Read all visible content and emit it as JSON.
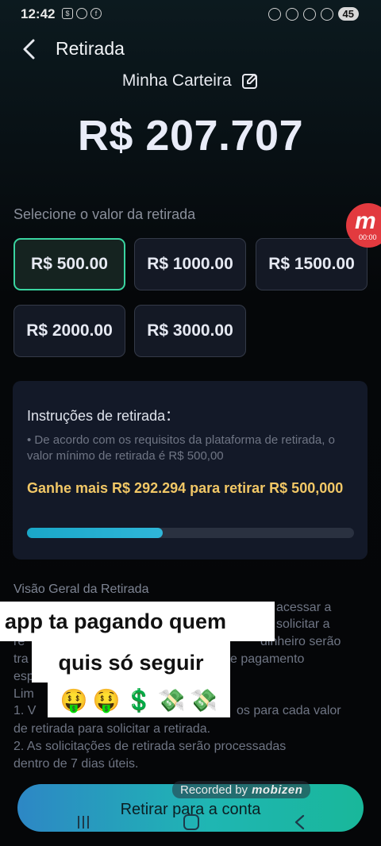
{
  "status_bar": {
    "time": "12:42",
    "left_icons": [
      "shopping-bag-icon",
      "whatsapp-icon",
      "facebook-icon"
    ],
    "right_icons": [
      "mute-icon",
      "wifi-icon",
      "do-not-disturb-icon",
      "block-icon"
    ],
    "battery": "45"
  },
  "header": {
    "title": "Retirada"
  },
  "wallet": {
    "label": "Minha Carteira",
    "balance": "R$ 207.707"
  },
  "amounts": {
    "label": "Selecione o valor da retirada",
    "options": [
      "R$ 500.00",
      "R$ 1000.00",
      "R$ 1500.00",
      "R$ 2000.00",
      "R$ 3000.00"
    ],
    "selected_index": 0
  },
  "recorder_badge": {
    "letter": "m",
    "timer": "00:00"
  },
  "instructions": {
    "title": "Instruções de retirada：",
    "text": "• De acordo com os requisitos da plataforma de retirada, o valor mínimo de retirada é R$ 500,00",
    "earn_more": "Ganhe mais R$ 292.294 para retirar R$ 500,000",
    "progress_fraction": 0.415
  },
  "overview": {
    "title": "Visão Geral da Retirada",
    "fragments": [
      "acessar a",
      "solicitar a",
      "re",
      "dinheiro serão",
      "tra",
      "e pagamento",
      "esp",
      "Lim",
      "1. V",
      "os para cada valor"
    ],
    "rules": [
      "de retirada para solicitar a retirada.",
      "2. As solicitações de retirada serão processadas",
      "dentro de 7 dias úteis."
    ]
  },
  "overlay_caption": {
    "line1": "app ta pagando quem",
    "line2": "quis só seguir",
    "emojis": [
      "🤑",
      "🤑",
      "💲",
      "💸",
      "💸"
    ]
  },
  "bottom_button": {
    "label": "Retirar para a conta"
  },
  "recording_banner": {
    "label": "Recorded by",
    "brand": "mobizen"
  },
  "colors": {
    "accent_green": "#3ad4a0",
    "gold_text": "#f1c766",
    "progress": "#1aa7c8",
    "card_bg": "#131928"
  }
}
